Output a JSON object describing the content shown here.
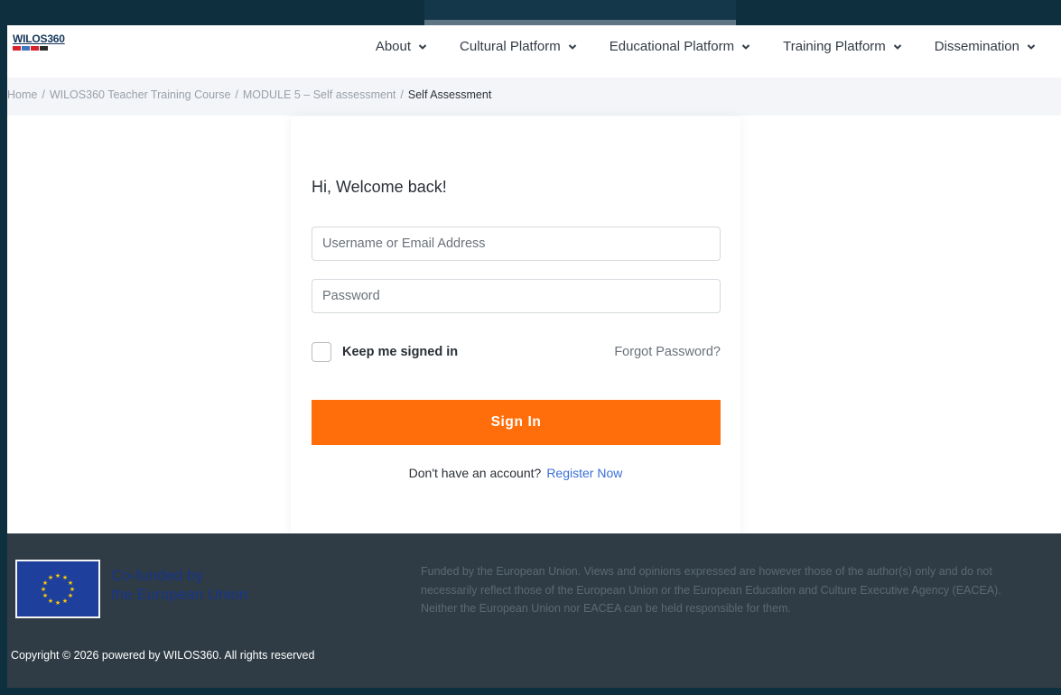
{
  "header": {
    "logo_text": "WILOS360",
    "nav": [
      {
        "label": "About"
      },
      {
        "label": "Cultural Platform"
      },
      {
        "label": "Educational Platform"
      },
      {
        "label": "Training Platform"
      },
      {
        "label": "Dissemination"
      }
    ]
  },
  "breadcrumb": {
    "items": [
      "Home",
      "WILOS360 Teacher Training Course",
      "MODULE 5 – Self assessment"
    ],
    "current": "Self Assessment",
    "separator": "/"
  },
  "login": {
    "welcome": "Hi, Welcome back!",
    "username_placeholder": "Username or Email Address",
    "password_placeholder": "Password",
    "remember_label": "Keep me signed in",
    "remember_checked": false,
    "forgot_label": "Forgot Password?",
    "signin_label": "Sign In",
    "no_account_text": "Don't have an account?",
    "register_label": "Register Now"
  },
  "footer": {
    "eu_line1": "Co-funded by",
    "eu_line2": "the European Union",
    "disclaimer": "Funded by the European Union. Views and opinions expressed are however those of the author(s) only and do not necessarily reflect those of the European Union or the European Education and Culture Executive Agency (EACEA). Neither the European Union nor EACEA can be held responsible for them.",
    "copyright": "Copyright © 2026 powered by WILOS360. All rights reserved"
  },
  "colors": {
    "accent": "#ff6e0a",
    "link": "#3a6fd8",
    "footer_bg": "#2f3c45",
    "outer_bg": "#0e2f3d",
    "eu_blue": "#1e3f9c",
    "eu_star": "#ffcc00"
  }
}
